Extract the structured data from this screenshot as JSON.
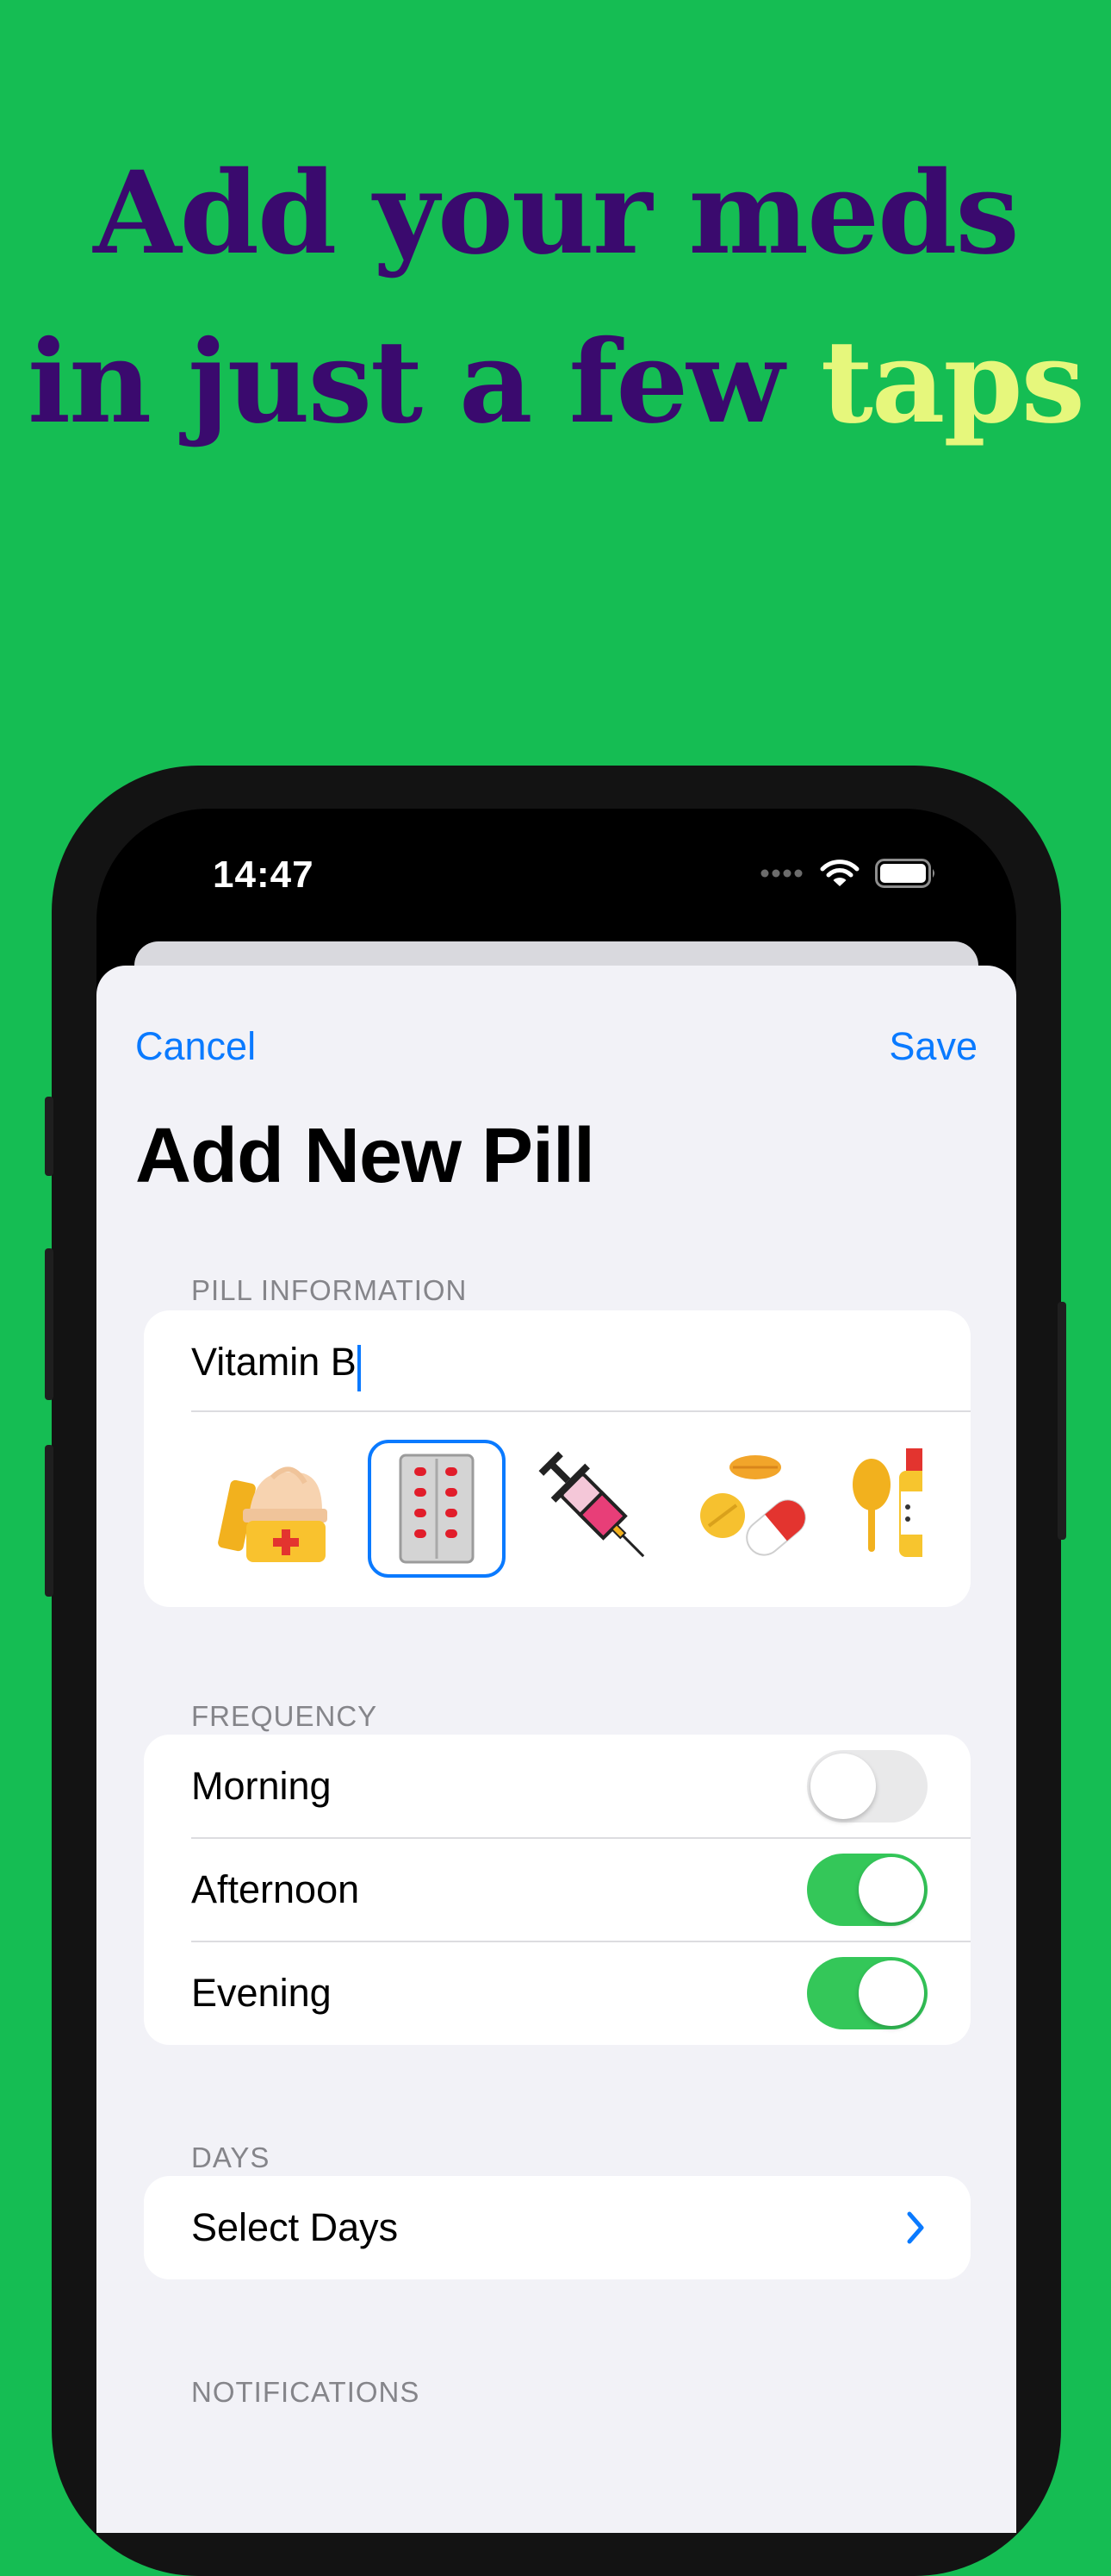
{
  "headline": {
    "line1": "Add your meds",
    "line2_prefix": "in just a few ",
    "line2_highlight": "taps"
  },
  "colors": {
    "background": "#15BD53",
    "headline": "#3A0A6E",
    "highlight": "#E6F77C",
    "accent": "#0A7AFF",
    "toggle_on": "#34C759"
  },
  "status_bar": {
    "time": "14:47",
    "icons": [
      "signal-dots-icon",
      "wifi-icon",
      "battery-icon"
    ]
  },
  "nav": {
    "cancel_label": "Cancel",
    "save_label": "Save"
  },
  "title": "Add New Pill",
  "pill_information": {
    "header": "PILL INFORMATION",
    "name_value": "Vitamin B",
    "icons": [
      "cream-jar-icon",
      "pill-blister-icon",
      "syringe-icon",
      "pills-capsule-icon",
      "spoon-bottle-icon"
    ],
    "selected_icon_index": 1
  },
  "frequency": {
    "header": "FREQUENCY",
    "items": [
      {
        "label": "Morning",
        "enabled": false
      },
      {
        "label": "Afternoon",
        "enabled": true
      },
      {
        "label": "Evening",
        "enabled": true
      }
    ]
  },
  "days": {
    "header": "DAYS",
    "select_label": "Select Days"
  },
  "notifications": {
    "header": "NOTIFICATIONS"
  }
}
